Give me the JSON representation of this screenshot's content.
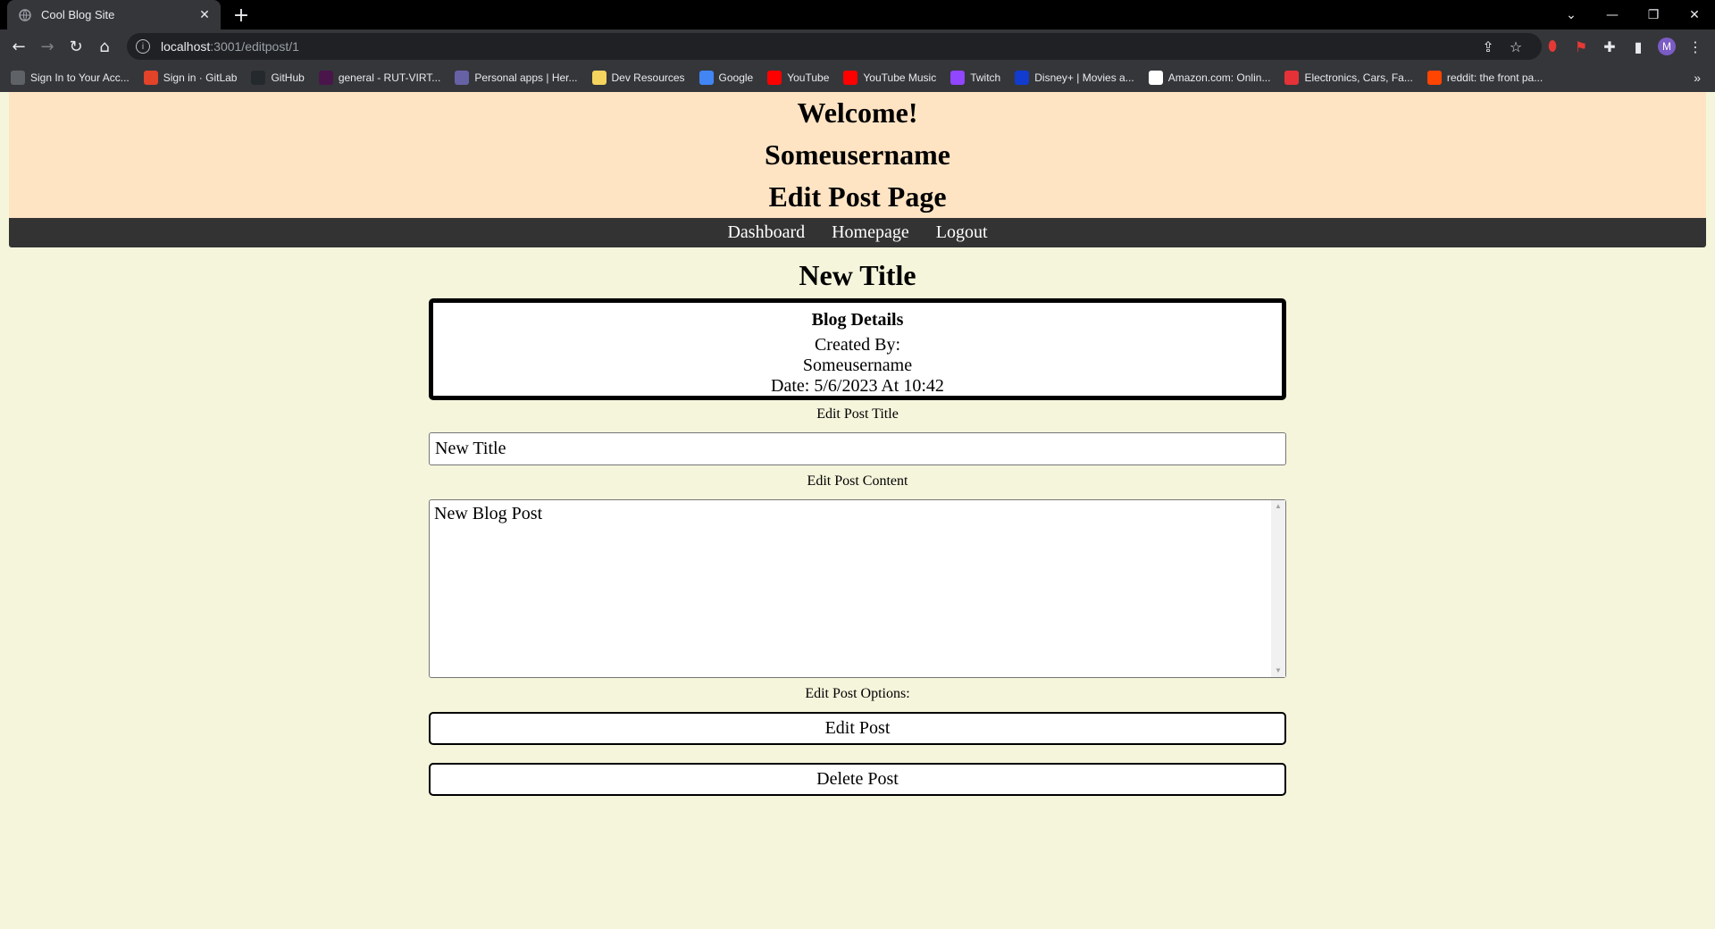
{
  "browser": {
    "tab_title": "Cool Blog Site",
    "url_host": "localhost",
    "url_path": ":3001/editpost/1",
    "profile_initial": "M",
    "bookmarks": [
      {
        "label": "Sign In to Your Acc...",
        "icon": "globe-icon",
        "color": "#5f6368"
      },
      {
        "label": "Sign in · GitLab",
        "icon": "gitlab-icon",
        "color": "#e24329"
      },
      {
        "label": "GitHub",
        "icon": "github-icon",
        "color": "#24292e"
      },
      {
        "label": "general - RUT-VIRT...",
        "icon": "slack-icon",
        "color": "#4a154b"
      },
      {
        "label": "Personal apps | Her...",
        "icon": "heroku-icon",
        "color": "#6762a6"
      },
      {
        "label": "Dev Resources",
        "icon": "folder-icon",
        "color": "#f4d35e"
      },
      {
        "label": "Google",
        "icon": "google-icon",
        "color": "#4285f4"
      },
      {
        "label": "YouTube",
        "icon": "youtube-icon",
        "color": "#ff0000"
      },
      {
        "label": "YouTube Music",
        "icon": "youtube-music-icon",
        "color": "#ff0000"
      },
      {
        "label": "Twitch",
        "icon": "twitch-icon",
        "color": "#9146ff"
      },
      {
        "label": "Disney+ | Movies a...",
        "icon": "disney-icon",
        "color": "#113ccf"
      },
      {
        "label": "Amazon.com: Onlin...",
        "icon": "amazon-icon",
        "color": "#ffffff"
      },
      {
        "label": "Electronics, Cars, Fa...",
        "icon": "ebay-icon",
        "color": "#e53238"
      },
      {
        "label": "reddit: the front pa...",
        "icon": "reddit-icon",
        "color": "#ff4500"
      }
    ]
  },
  "header": {
    "welcome": "Welcome!",
    "username": "Someusername",
    "page_name": "Edit Post Page"
  },
  "nav": {
    "dashboard": "Dashboard",
    "homepage": "Homepage",
    "logout": "Logout"
  },
  "post": {
    "title": "New Title",
    "details_heading": "Blog Details",
    "created_by_label": "Created By:",
    "author": "Someusername",
    "date": "Date: 5/6/2023 At 10:42"
  },
  "form": {
    "title_label": "Edit Post Title",
    "title_value": "New Title",
    "content_label": "Edit Post Content",
    "content_value": "New Blog Post",
    "options_label": "Edit Post Options:",
    "edit_button": "Edit Post",
    "delete_button": "Delete Post"
  }
}
